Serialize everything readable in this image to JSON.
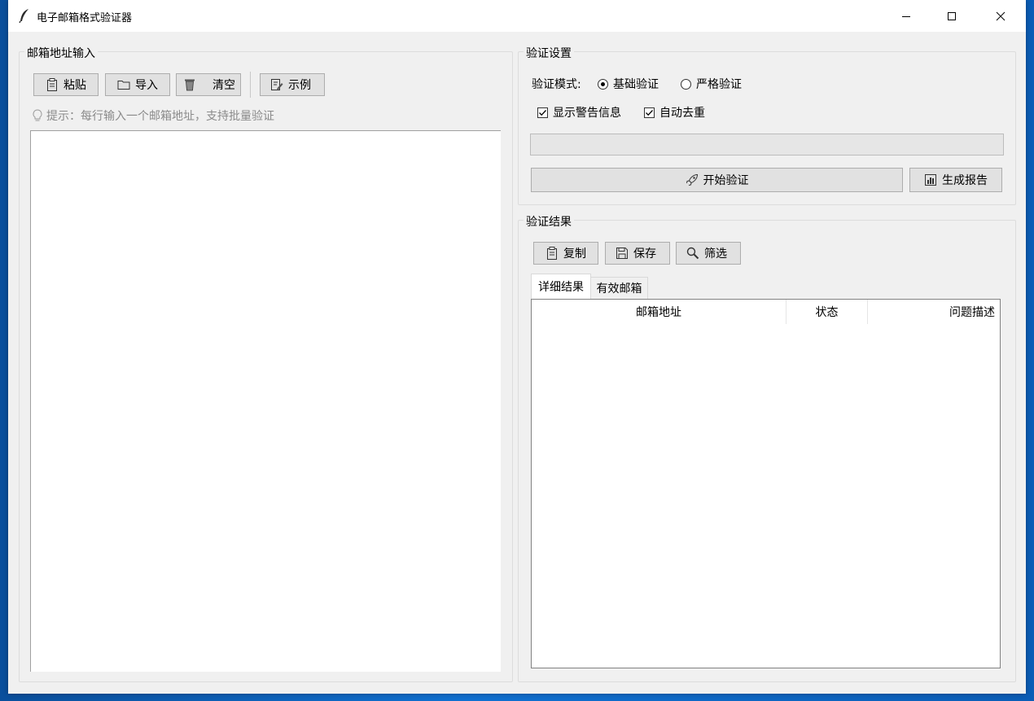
{
  "window": {
    "title": "电子邮箱格式验证器",
    "minimize_icon": "minimize-icon",
    "maximize_icon": "maximize-icon",
    "close_icon": "close-icon"
  },
  "input_panel": {
    "legend": "邮箱地址输入",
    "toolbar": [
      {
        "label": "粘贴",
        "icon": "clipboard-icon"
      },
      {
        "label": "导入",
        "icon": "folder-icon"
      },
      {
        "label": "清空",
        "icon": "trash-icon"
      },
      {
        "label": "示例",
        "icon": "edit-document-icon"
      }
    ],
    "hint": "提示：每行输入一个邮箱地址，支持批量验证",
    "hint_icon": "lightbulb-icon",
    "text_value": ""
  },
  "settings_panel": {
    "legend": "验证设置",
    "mode_label": "验证模式:",
    "modes": [
      {
        "label": "基础验证",
        "selected": true
      },
      {
        "label": "严格验证",
        "selected": false
      }
    ],
    "options": [
      {
        "label": "显示警告信息",
        "checked": true
      },
      {
        "label": "自动去重",
        "checked": true
      }
    ],
    "progress": 0,
    "start_button": {
      "label": "开始验证",
      "icon": "rocket-icon"
    },
    "report_button": {
      "label": "生成报告",
      "icon": "bar-chart-icon"
    }
  },
  "results_panel": {
    "legend": "验证结果",
    "toolbar": [
      {
        "label": "复制",
        "icon": "clipboard-icon"
      },
      {
        "label": "保存",
        "icon": "floppy-disk-icon"
      },
      {
        "label": "筛选",
        "icon": "search-icon"
      }
    ],
    "tabs": [
      {
        "label": "详细结果",
        "active": true
      },
      {
        "label": "有效邮箱",
        "active": false
      }
    ],
    "columns": [
      "邮箱地址",
      "状态",
      "问题描述"
    ],
    "rows": []
  },
  "colors": {
    "window_bg": "#f0f0f0",
    "titlebar_bg": "#ffffff",
    "button_bg": "#e1e1e1",
    "hint_text": "#8a8a8a"
  }
}
